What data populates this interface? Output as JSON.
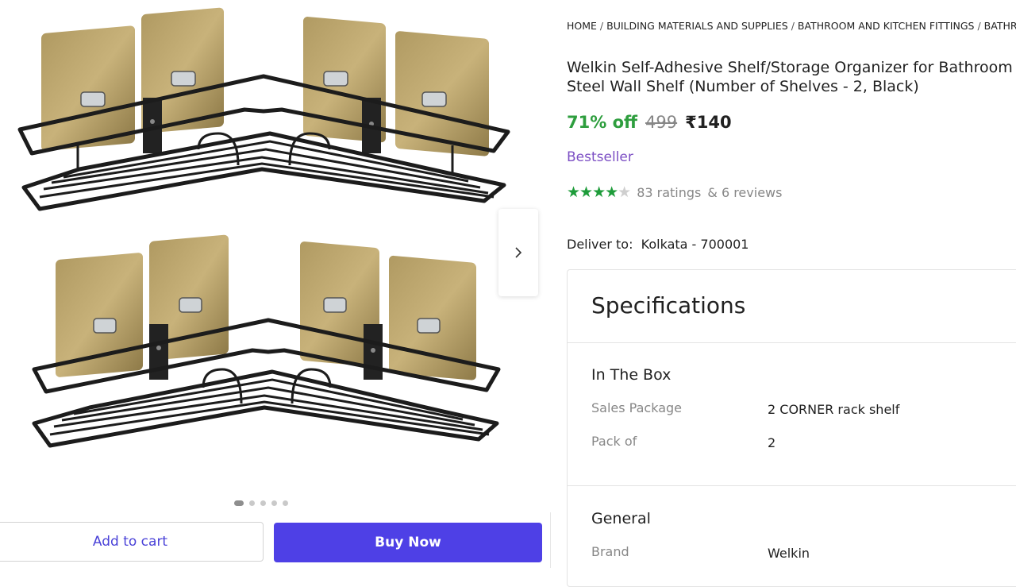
{
  "breadcrumb": [
    "HOME",
    "BUILDING MATERIALS AND SUPPLIES",
    "BATHROOM AND KITCHEN FITTINGS",
    "BATHRO"
  ],
  "product": {
    "title": "Welkin Self-Adhesive Shelf/Storage Organizer for Bathroom & Steel Wall Shelf (Number of Shelves - 2, Black)",
    "title_line1": "Welkin Self-Adhesive Shelf/Storage Organizer for Bathroom &",
    "title_line2": "Steel Wall Shelf (Number of Shelves - 2, Black)",
    "discount": "71% off",
    "mrp": "499",
    "price": "₹140",
    "badge": "Bestseller",
    "rating_stars": 4.5,
    "ratings": "83 ratings",
    "reviews": "& 6 reviews",
    "image_icon": "corner-shelf-rack-image"
  },
  "gallery": {
    "total_images": 5,
    "active_index": 0,
    "next_icon": "chevron-right-icon"
  },
  "delivery": {
    "label": "Deliver to:",
    "location": "Kolkata - 700001"
  },
  "actions": {
    "add_to_cart": "Add to cart",
    "buy_now": "Buy Now"
  },
  "specifications": {
    "heading": "Specifications",
    "sections": [
      {
        "title": "In The Box",
        "rows": [
          {
            "key": "Sales Package",
            "value": "2 CORNER rack shelf"
          },
          {
            "key": "Pack of",
            "value": "2"
          }
        ]
      },
      {
        "title": "General",
        "rows": [
          {
            "key": "Brand",
            "value": "Welkin"
          }
        ]
      }
    ]
  },
  "colors": {
    "discount_green": "#2e9e3e",
    "badge_purple": "#7c4fc4",
    "buy_button": "#4e40e6",
    "cart_text": "#4a42d8",
    "star_green": "#1e9c3a"
  }
}
